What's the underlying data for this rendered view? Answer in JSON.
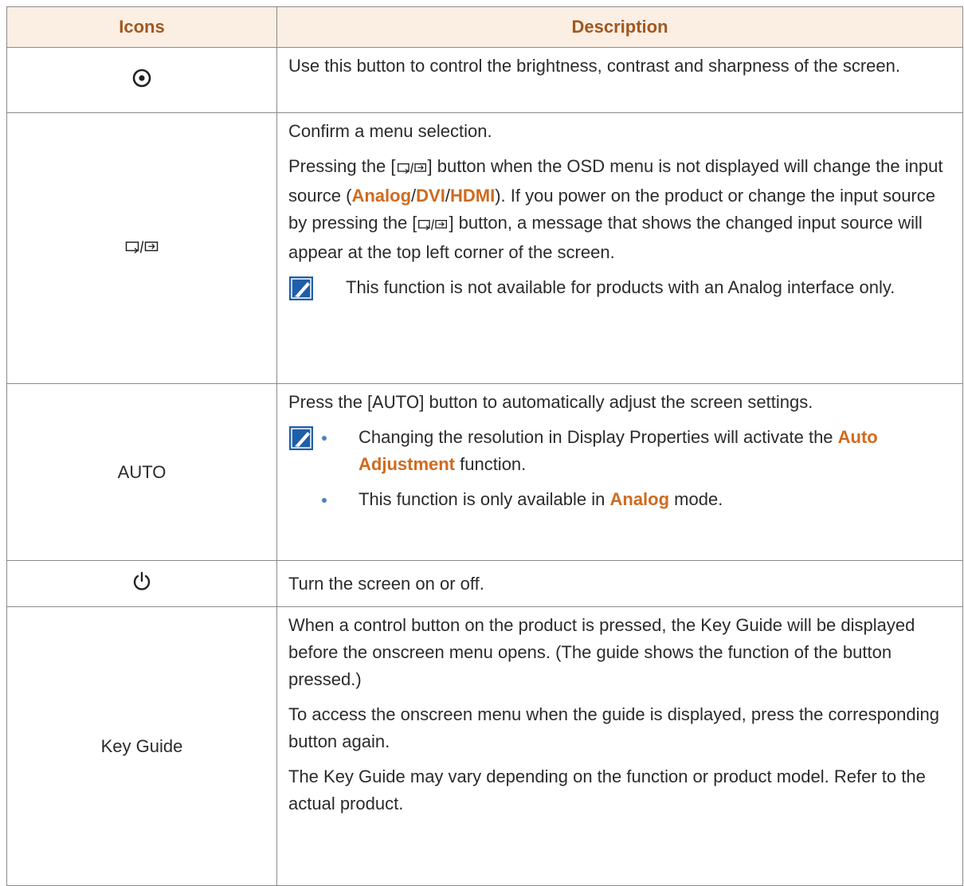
{
  "table": {
    "header": {
      "col1": "Icons",
      "col2": "Description"
    },
    "rows": [
      {
        "icon_name": "adjust-target-icon",
        "desc": "Use this button to control the brightness, contrast and sharpness of the screen."
      },
      {
        "icon_name": "source-enter-icon",
        "p1": "Confirm a menu selection.",
        "p2_before": "Pressing the [",
        "p2_after": "] button when the OSD menu is not displayed will change the input source (",
        "src_analog": "Analog",
        "src_dvi": "DVI",
        "src_hdmi": "HDMI",
        "slash": "/",
        "p2_close": "). If you power on the product or change the input source by pressing the [",
        "p2_end": "] button, a message that shows the changed input source will appear at the top left corner of the screen.",
        "note": "This function is not available for products with an Analog interface only."
      },
      {
        "icon_label": "AUTO",
        "p1_before": "Press the [",
        "p1_key": "AUTO",
        "p1_after": "] button to automatically adjust the screen settings.",
        "b1_before": "Changing the resolution in Display Properties will activate the ",
        "b1_hl": "Auto Adjustment",
        "b1_after": " function.",
        "b2_before": "This function is only available in ",
        "b2_hl": "Analog",
        "b2_after": " mode."
      },
      {
        "icon_name": "power-icon",
        "desc": "Turn the screen on or off."
      },
      {
        "icon_label": "Key Guide",
        "p1": "When a control button on the product is pressed, the Key Guide will be displayed before the onscreen menu opens. (The guide shows the function of the button pressed.)",
        "p2": "To access the onscreen menu when the guide is displayed, press the corresponding button again.",
        "p3": "The Key Guide may vary depending on the function or product model. Refer to the actual product."
      }
    ]
  },
  "colors": {
    "header_bg": "#fbeee3",
    "header_text": "#a0581f",
    "highlight": "#d06a1e",
    "bullet": "#4f7fc3",
    "note_icon": "#1f5ea8"
  }
}
